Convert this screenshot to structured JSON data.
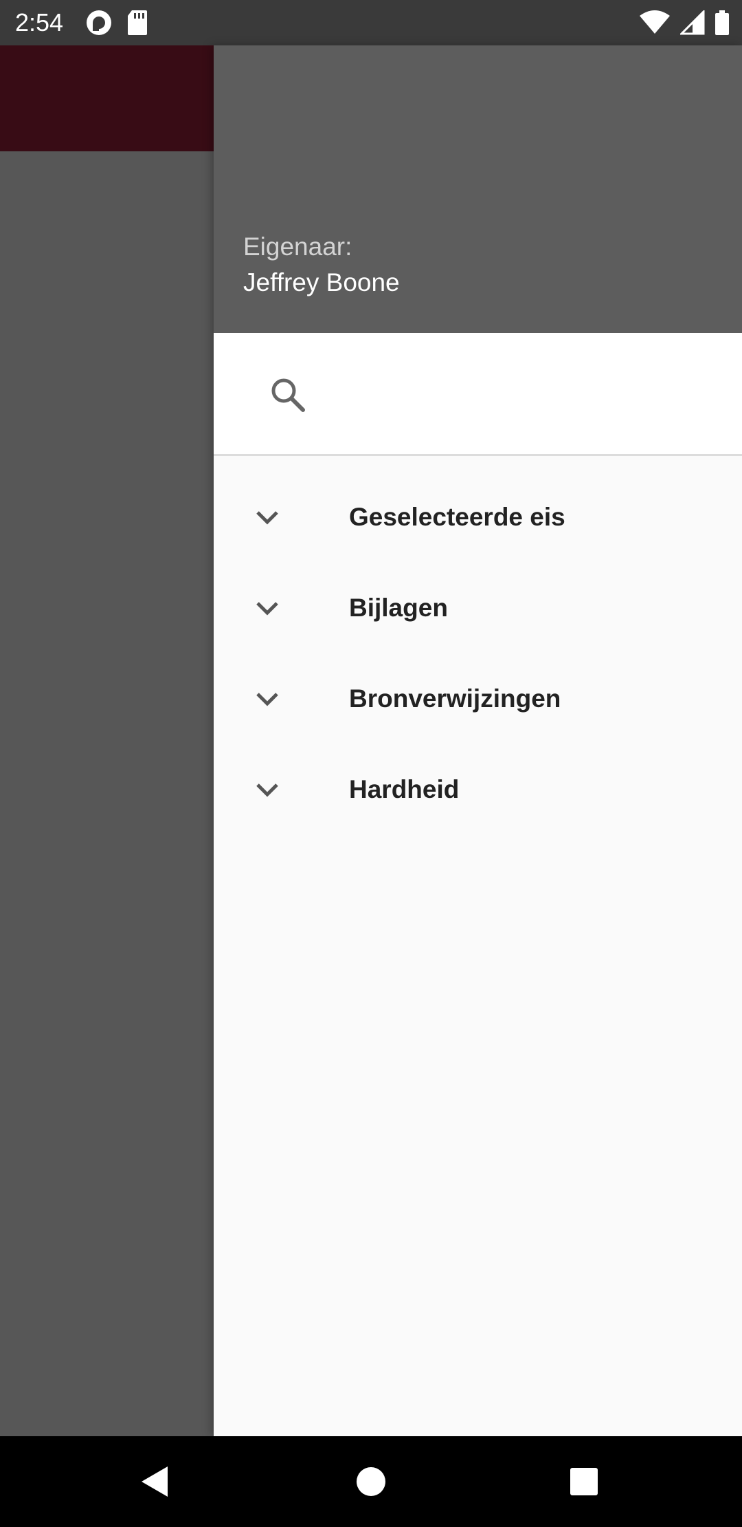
{
  "status_bar": {
    "time": "2:54",
    "left_icons": [
      "pocket-casts-icon",
      "sd-card-icon"
    ],
    "right_icons": [
      "wifi-icon",
      "signal-icon",
      "battery-icon"
    ]
  },
  "background": {
    "appbar_color": "#8c1f36"
  },
  "drawer": {
    "owner_label": "Eigenaar:",
    "owner_name": "Jeffrey Boone",
    "search": {
      "value": "",
      "placeholder": ""
    },
    "items": [
      {
        "label": "Geselecteerde eis",
        "icon": "chevron-down-icon"
      },
      {
        "label": "Bijlagen",
        "icon": "chevron-down-icon"
      },
      {
        "label": "Bronverwijzingen",
        "icon": "chevron-down-icon"
      },
      {
        "label": "Hardheid",
        "icon": "chevron-down-icon"
      }
    ]
  },
  "nav_bar": {
    "buttons": [
      "back-icon",
      "home-icon",
      "recents-icon"
    ]
  }
}
